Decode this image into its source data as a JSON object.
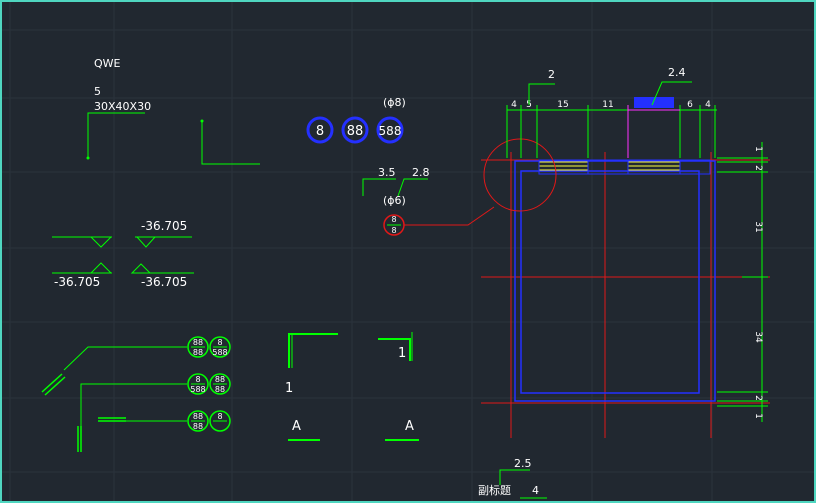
{
  "colors": {
    "background": "#212830",
    "frame": "#4fd6c0",
    "grid": "#2b333c",
    "annotation": "#00ff00",
    "text": "#ffffff",
    "axis_red": "#e01818",
    "wall_blue": "#2430ff",
    "accent_magenta": "#ff30ff",
    "accent_yellow": "#ffff40"
  },
  "leader_note": {
    "title": "QWE",
    "number": "5",
    "size": "30X40X30"
  },
  "circle_tags": {
    "tag1": "8",
    "tag2": "88",
    "tag3": "588",
    "dia_label": "(ϕ8)"
  },
  "rebar_label": {
    "left_value": "3.5",
    "right_value": "2.8",
    "dia_label": "(ϕ6)",
    "bubble_top": "8",
    "bubble_bottom": "8"
  },
  "elevation_marks": {
    "top_left": "-36.705",
    "bottom_left": "-36.705",
    "bottom_right": "-36.705"
  },
  "split_bubbles": [
    {
      "left_top": "88",
      "left_bottom": "88",
      "right_top": "8",
      "right_bottom": "588"
    },
    {
      "left_top": "8",
      "left_bottom": "588",
      "right_top": "88",
      "right_bottom": "88"
    },
    {
      "left_top": "88",
      "left_bottom": "88",
      "right_top": "8",
      "right_bottom": ""
    }
  ],
  "section_marks": {
    "corner_label": "1",
    "bracket_label": "1",
    "letter_left": "A",
    "letter_right": "A"
  },
  "plan_dims": {
    "callout_left": "2",
    "callout_right": "2.4",
    "top": [
      "4",
      "5",
      "15",
      "11",
      "6",
      "4"
    ],
    "right": [
      "1",
      "2",
      "31",
      "34",
      "2",
      "1"
    ]
  },
  "subtitle": {
    "label": "副标题",
    "scale_value": "2.5",
    "number": "4"
  }
}
